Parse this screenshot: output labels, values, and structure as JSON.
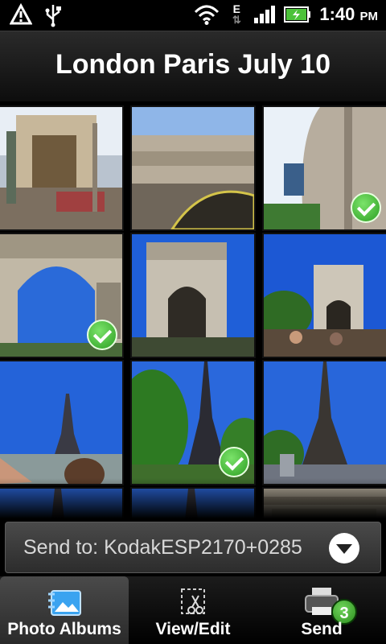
{
  "status_bar": {
    "time": "1:40",
    "ampm": "PM",
    "network_type": "E",
    "icons": [
      "warning-icon",
      "usb-icon",
      "wifi-icon",
      "data-arrows-icon",
      "signal-icon",
      "battery-charging-icon"
    ]
  },
  "header": {
    "title": "London Paris July 10"
  },
  "grid": {
    "photos": [
      {
        "selected": false,
        "scene": "street"
      },
      {
        "selected": false,
        "scene": "arch-top"
      },
      {
        "selected": true,
        "scene": "arch-side"
      },
      {
        "selected": false,
        "scene": "arch-under"
      },
      {
        "selected": false,
        "scene": "arch-front"
      },
      {
        "selected": false,
        "scene": "arch-trees"
      },
      {
        "selected": false,
        "scene": "eiffel-water"
      },
      {
        "selected": true,
        "scene": "eiffel-trees"
      },
      {
        "selected": false,
        "scene": "eiffel-fountain"
      },
      {
        "selected": false,
        "scene": "eiffel-partial"
      },
      {
        "selected": false,
        "scene": "eiffel-partial"
      },
      {
        "selected": false,
        "scene": "building-partial"
      }
    ]
  },
  "send_to": {
    "label": "Send to: KodakESP2170+0285"
  },
  "tabs": [
    {
      "label": "Photo Albums",
      "icon": "photo-albums-icon",
      "active": true
    },
    {
      "label": "View/Edit",
      "icon": "crop-scissors-icon",
      "active": false
    },
    {
      "label": "Send",
      "icon": "printer-icon",
      "active": false,
      "badge": "3"
    }
  ],
  "colors": {
    "check": "#3fbf2e",
    "badge": "#3fb22b",
    "sky": "#1f5fd8"
  }
}
